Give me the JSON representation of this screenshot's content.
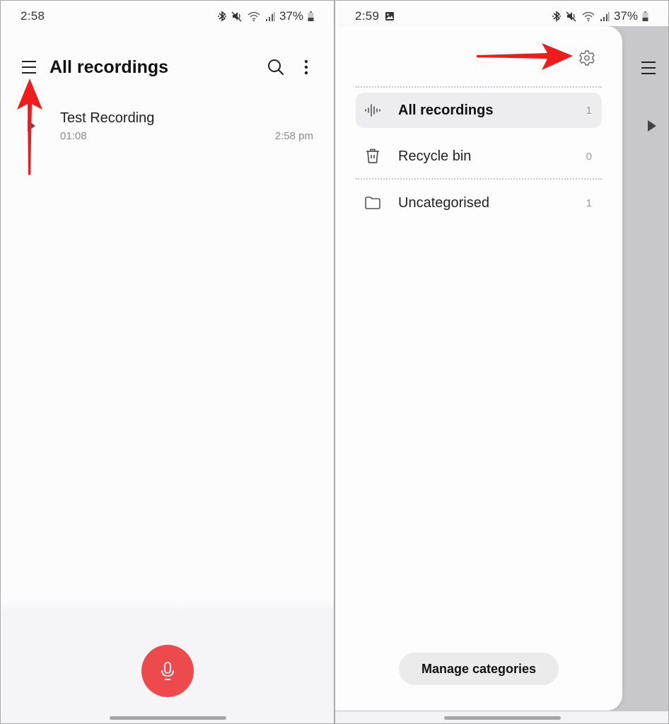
{
  "left_screen": {
    "status_bar": {
      "time": "2:58",
      "battery_percent": "37%",
      "icons": [
        "bluetooth-icon",
        "mute-icon",
        "wifi-icon",
        "signal-icon",
        "battery-icon"
      ]
    },
    "app_bar": {
      "title": "All recordings",
      "menu_icon": "hamburger-menu-icon",
      "search_icon": "search-icon",
      "more_icon": "more-vertical-icon"
    },
    "recordings": [
      {
        "title": "Test Recording",
        "duration": "01:08",
        "time": "2:58 pm"
      }
    ],
    "record_button_icon": "microphone-icon",
    "annotation_arrow": {
      "color": "#ee1c1c",
      "direction": "up",
      "target": "menu"
    }
  },
  "right_screen": {
    "status_bar": {
      "time": "2:59",
      "battery_percent": "37%",
      "icons": [
        "image-icon",
        "bluetooth-icon",
        "mute-icon",
        "wifi-icon",
        "signal-icon",
        "battery-icon"
      ]
    },
    "drawer": {
      "settings_icon": "gear-icon",
      "items": [
        {
          "label": "All recordings",
          "count": "1",
          "icon": "waveform-icon",
          "active": true
        },
        {
          "label": "Recycle bin",
          "count": "0",
          "icon": "trash-icon",
          "active": false
        },
        {
          "label": "Uncategorised",
          "count": "1",
          "icon": "folder-icon",
          "active": false
        }
      ],
      "manage_button_label": "Manage categories"
    },
    "annotation_arrow": {
      "color": "#ee1c1c",
      "direction": "right",
      "target": "settings"
    }
  },
  "colors": {
    "record_button": "#ec4a4c",
    "annotation": "#ee1c1c",
    "active_item_bg": "#ededef"
  }
}
